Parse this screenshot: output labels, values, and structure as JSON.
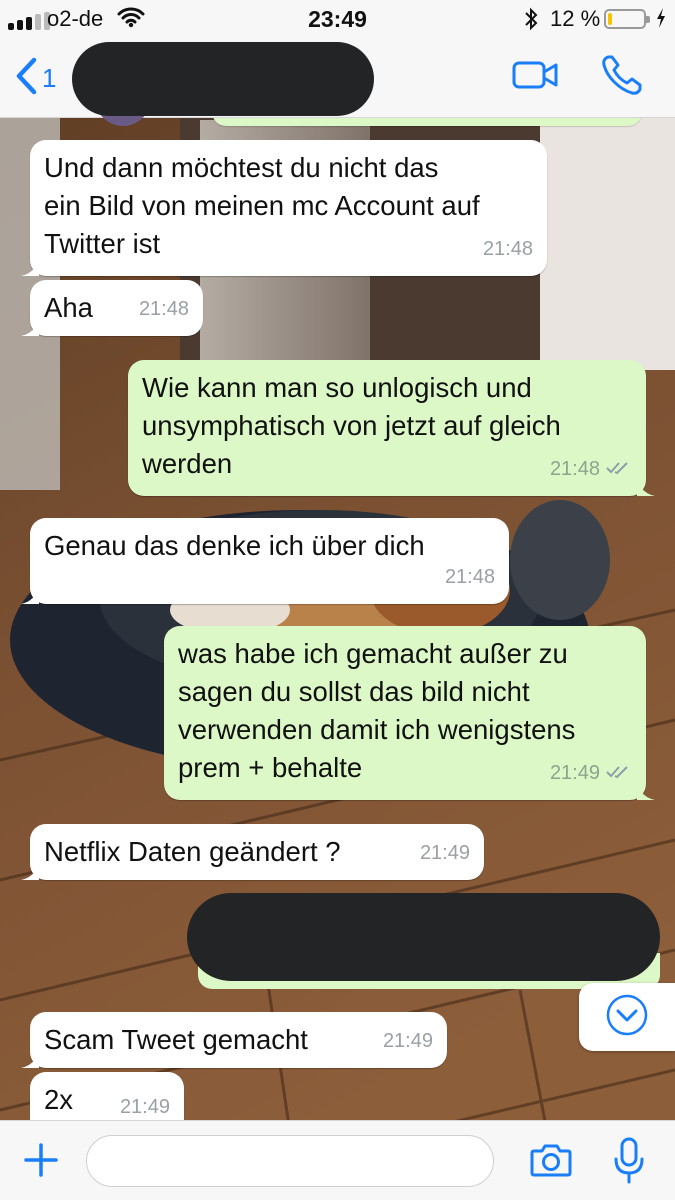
{
  "status_bar": {
    "carrier": "o2-de",
    "time": "23:49",
    "battery_percent": "12 %",
    "battery_level": 0.12
  },
  "header": {
    "back_count": "1",
    "contact_name_redacted": true
  },
  "messages": [
    {
      "direction": "incoming",
      "text": "Und dann möchtest du nicht das\nein Bild von meinen mc Account auf\nTwitter ist",
      "time": "21:48"
    },
    {
      "direction": "incoming",
      "text": "Aha",
      "time": "21:48"
    },
    {
      "direction": "outgoing",
      "text": "Wie kann man so unlogisch und\nunsymphatisch von jetzt auf gleich\nwerden",
      "time": "21:48",
      "read": true
    },
    {
      "direction": "incoming",
      "text": "Genau das denke ich über dich",
      "time": "21:48"
    },
    {
      "direction": "outgoing",
      "text": "was habe ich gemacht außer zu\nsagen du sollst das bild nicht\nverwenden damit ich wenigstens\nprem + behalte",
      "time": "21:49",
      "read": true
    },
    {
      "direction": "incoming",
      "text": "Netflix Daten geändert ?",
      "time": "21:49"
    },
    {
      "direction": "outgoing",
      "text": "",
      "time": "",
      "redacted": true
    },
    {
      "direction": "incoming",
      "text": "Scam Tweet gemacht",
      "time": "21:49"
    },
    {
      "direction": "incoming",
      "text": "2x",
      "time": "21:49"
    }
  ],
  "input": {
    "placeholder": "",
    "value": ""
  },
  "icons": {
    "back": "chevron-left-icon",
    "video": "video-camera-icon",
    "call": "phone-icon",
    "scroll": "chevron-down-circle-icon",
    "attach": "plus-icon",
    "camera": "camera-icon",
    "mic": "microphone-icon"
  },
  "colors": {
    "accent": "#1a7efb",
    "incoming_bubble": "#ffffff",
    "outgoing_bubble": "#dcf8c6",
    "battery_fill": "#f5c400"
  }
}
